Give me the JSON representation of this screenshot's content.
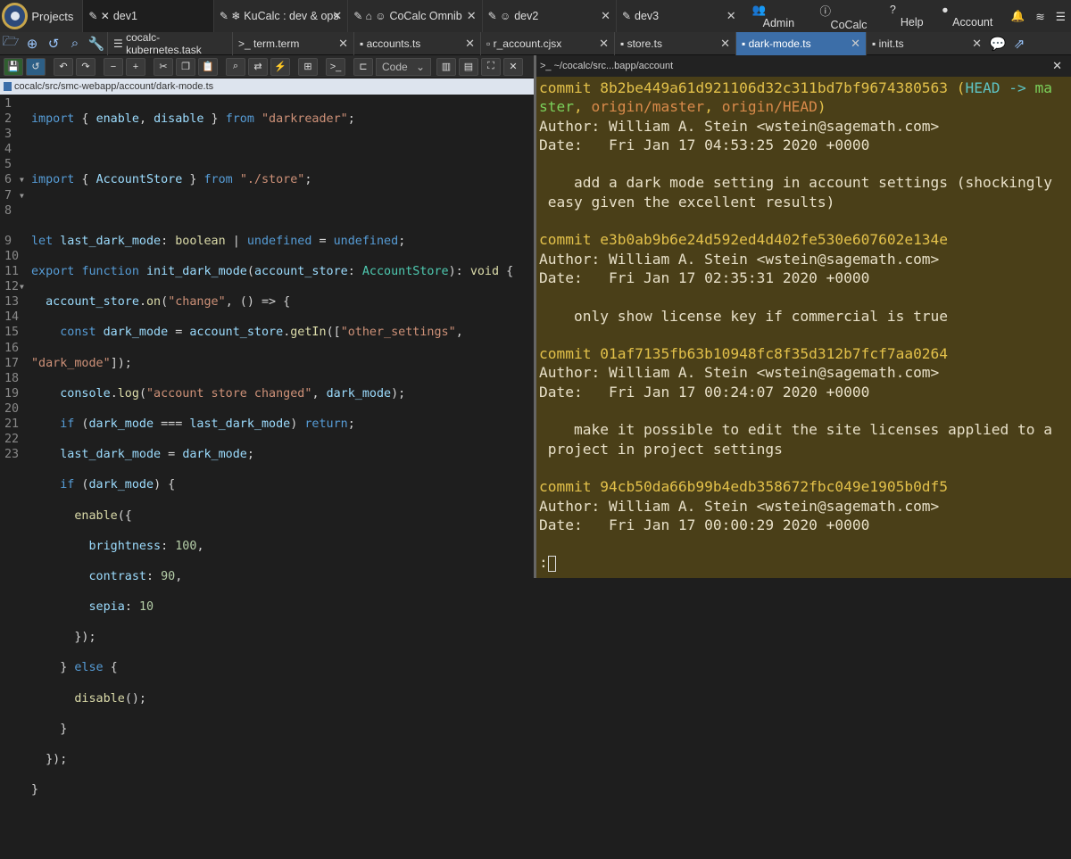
{
  "topbar": {
    "projects": "Projects",
    "tabs": [
      {
        "label": "dev1",
        "active": true
      },
      {
        "label": "KuCalc : dev & ops",
        "active": false
      },
      {
        "label": "CoCalc Omnib",
        "active": false
      },
      {
        "label": "dev2",
        "active": false
      },
      {
        "label": "dev3",
        "active": false
      }
    ],
    "right": {
      "admin": "Admin",
      "cocalc": "CoCalc",
      "help": "Help",
      "account": "Account"
    }
  },
  "files": [
    {
      "label": "cocalc-kubernetes.task",
      "active": false
    },
    {
      "label": "term.term",
      "active": false
    },
    {
      "label": "accounts.ts",
      "active": false
    },
    {
      "label": "r_account.cjsx",
      "active": false
    },
    {
      "label": "store.ts",
      "active": false
    },
    {
      "label": "dark-mode.ts",
      "active": true
    },
    {
      "label": "init.ts",
      "active": false
    }
  ],
  "toolbar": {
    "mode": "Code"
  },
  "path": "cocalc/src/smc-webapp/account/dark-mode.ts",
  "terminal_title": "~/cocalc/src...bapp/account",
  "line_count": 23,
  "terminal": {
    "c1": "commit 8b2be449a61d921106d32c311bd7bf9674380563 (HEAD -> ma",
    "c1b": "ster, origin/master, origin/HEAD)",
    "a1": "Author: William A. Stein <wstein@sagemath.com>",
    "d1": "Date:   Fri Jan 17 04:53:25 2020 +0000",
    "m1a": "    add a dark mode setting in account settings (shockingly",
    "m1b": " easy given the excellent results)",
    "c2": "commit e3b0ab9b6e24d592ed4d402fe530e607602e134e",
    "a2": "Author: William A. Stein <wstein@sagemath.com>",
    "d2": "Date:   Fri Jan 17 02:35:31 2020 +0000",
    "m2": "    only show license key if commercial is true",
    "c3": "commit 01af7135fb63b10948fc8f35d312b7fcf7aa0264",
    "a3": "Author: William A. Stein <wstein@sagemath.com>",
    "d3": "Date:   Fri Jan 17 00:24:07 2020 +0000",
    "m3a": "    make it possible to edit the site licenses applied to a",
    "m3b": " project in project settings",
    "c4": "commit 94cb50da66b99b4edb358672fbc049e1905b0df5",
    "a4": "Author: William A. Stein <wstein@sagemath.com>",
    "d4": "Date:   Fri Jan 17 00:00:29 2020 +0000",
    "prompt": ":"
  }
}
